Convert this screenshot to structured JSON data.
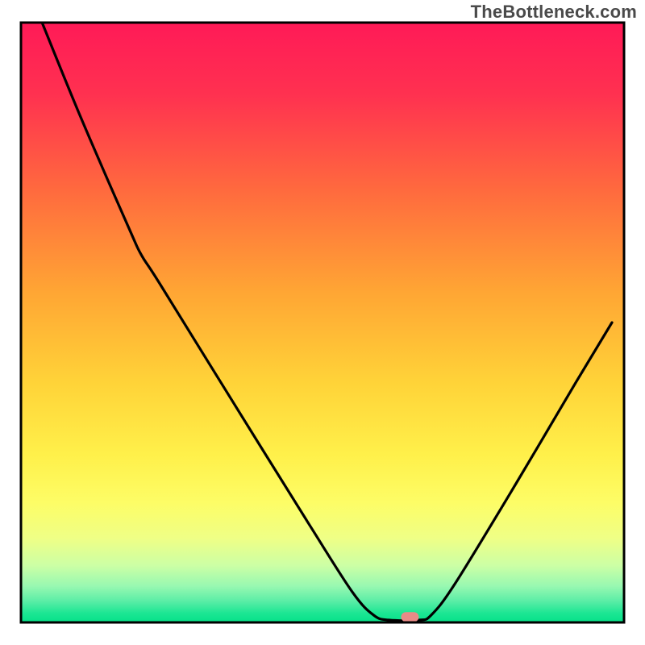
{
  "watermark": "TheBottleneck.com",
  "chart_data": {
    "type": "line",
    "title": "",
    "xlabel": "",
    "ylabel": "",
    "xlim": [
      0,
      100
    ],
    "ylim": [
      0,
      100
    ],
    "description": "Bottleneck curve over a green-to-red vertical gradient background. V-shaped black curve with minimum near x≈65. A small pink marker sits at the minimum on the baseline.",
    "gradient_stops": [
      {
        "offset": 0.0,
        "color": "#ff1a57"
      },
      {
        "offset": 0.12,
        "color": "#ff3150"
      },
      {
        "offset": 0.28,
        "color": "#ff6a3e"
      },
      {
        "offset": 0.45,
        "color": "#ffa634"
      },
      {
        "offset": 0.6,
        "color": "#ffd338"
      },
      {
        "offset": 0.72,
        "color": "#fff04a"
      },
      {
        "offset": 0.8,
        "color": "#fdfd66"
      },
      {
        "offset": 0.86,
        "color": "#efff86"
      },
      {
        "offset": 0.905,
        "color": "#ccffa5"
      },
      {
        "offset": 0.94,
        "color": "#97f8b1"
      },
      {
        "offset": 0.965,
        "color": "#59eda6"
      },
      {
        "offset": 0.985,
        "color": "#1be693"
      },
      {
        "offset": 1.0,
        "color": "#06e189"
      }
    ],
    "curve_points": [
      {
        "x": 3.5,
        "y": 100.0
      },
      {
        "x": 10.0,
        "y": 84.0
      },
      {
        "x": 18.0,
        "y": 65.5
      },
      {
        "x": 20.0,
        "y": 61.2
      },
      {
        "x": 23.0,
        "y": 56.5
      },
      {
        "x": 35.0,
        "y": 37.0
      },
      {
        "x": 48.0,
        "y": 16.0
      },
      {
        "x": 55.0,
        "y": 5.0
      },
      {
        "x": 58.5,
        "y": 1.2
      },
      {
        "x": 61.0,
        "y": 0.4
      },
      {
        "x": 66.0,
        "y": 0.4
      },
      {
        "x": 68.0,
        "y": 1.2
      },
      {
        "x": 72.0,
        "y": 6.5
      },
      {
        "x": 82.0,
        "y": 23.0
      },
      {
        "x": 92.0,
        "y": 40.0
      },
      {
        "x": 98.0,
        "y": 50.0
      }
    ],
    "marker": {
      "x": 64.5,
      "y": 0.9,
      "color": "#e98b87"
    },
    "plot_area_border_color": "#000000",
    "plot_area_border_width": 3
  }
}
